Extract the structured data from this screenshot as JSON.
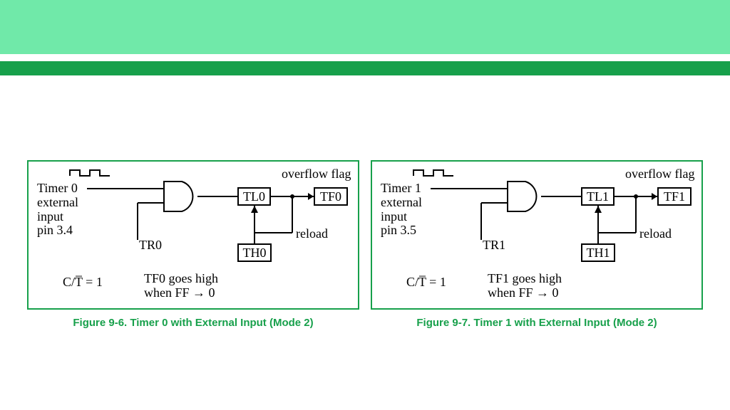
{
  "banner": {},
  "figures": {
    "left": {
      "caption": "Figure 9-6. Timer 0 with External Input (Mode 2)",
      "input_label": "Timer 0\nexternal\ninput\npin 3.4",
      "tr": "TR0",
      "tl": "TL0",
      "th": "TH0",
      "tf": "TF0",
      "overflow": "overflow flag",
      "reload": "reload",
      "ct": "C/T̅ = 1",
      "note_l1": "TF0 goes high",
      "note_l2": "when FF → 0"
    },
    "right": {
      "caption": "Figure 9-7. Timer 1 with External Input (Mode 2)",
      "input_label": "Timer 1\nexternal\ninput\npin 3.5",
      "tr": "TR1",
      "tl": "TL1",
      "th": "TH1",
      "tf": "TF1",
      "overflow": "overflow flag",
      "reload": "reload",
      "ct": "C/T̅ = 1",
      "note_l1": "TF1 goes high",
      "note_l2": "when FF → 0"
    }
  }
}
